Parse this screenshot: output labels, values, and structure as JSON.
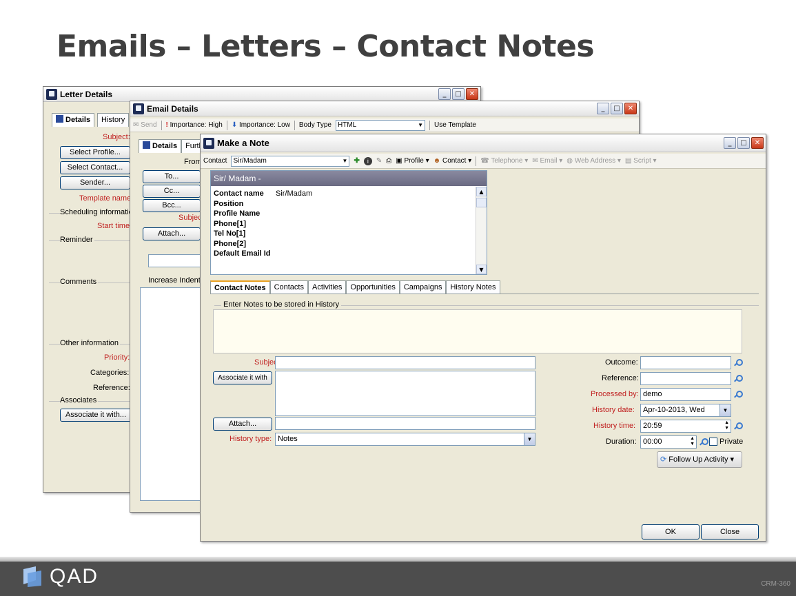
{
  "slide": {
    "title": "Emails – Letters – Contact Notes",
    "logo_text": "QAD",
    "slide_code": "CRM-360"
  },
  "letter_window": {
    "title": "Letter Details",
    "tabs": [
      "Details",
      "History"
    ],
    "subject_label": "Subject:",
    "buttons": [
      "Select Profile...",
      "Select Contact...",
      "Sender..."
    ],
    "template_label": "Template name:",
    "scheduling_label": "Scheduling information",
    "start_label": "Start time:",
    "reminder_label": "Reminder",
    "comments_label": "Comments",
    "other_label": "Other information",
    "priority_label": "Priority:",
    "categories_label": "Categories:",
    "reference_label": "Reference:",
    "associates_label": "Associates",
    "associate_button": "Associate it with..."
  },
  "email_window": {
    "title": "Email Details",
    "toolbar": {
      "send": "Send",
      "importance_high": "Importance: High",
      "importance_low": "Importance: Low",
      "body_type_label": "Body Type",
      "body_type_value": "HTML",
      "use_template": "Use Template"
    },
    "tabs": [
      "Details",
      "Furth"
    ],
    "from_label": "From",
    "buttons": [
      "To...",
      "Cc...",
      "Bcc...",
      "Attach..."
    ],
    "subject_label": "Subject",
    "increase_indent": "Increase Indent"
  },
  "note_window": {
    "title": "Make a Note",
    "toolbar": {
      "contact_label": "Contact",
      "contact_value": "Sir/Madam",
      "profile": "Profile",
      "contact_menu": "Contact",
      "telephone": "Telephone",
      "email": "Email",
      "web_address": "Web Address",
      "script": "Script"
    },
    "contact_header": "Sir/ Madam -",
    "contact_fields": [
      {
        "label": "Contact name",
        "value": "Sir/Madam"
      },
      {
        "label": "Position",
        "value": ""
      },
      {
        "label": "Profile Name",
        "value": ""
      },
      {
        "label": "Phone[1]",
        "value": ""
      },
      {
        "label": "Tel No[1]",
        "value": ""
      },
      {
        "label": "Phone[2]",
        "value": ""
      },
      {
        "label": "Default Email Id",
        "value": ""
      }
    ],
    "tabs": [
      "Contact Notes",
      "Contacts",
      "Activities",
      "Opportunities",
      "Campaigns",
      "History Notes"
    ],
    "notes_group_label": "Enter Notes to be stored in History",
    "subject_label": "Subject:",
    "associate_button": "Associate it with",
    "attach_button": "Attach...",
    "history_type_label": "History type:",
    "history_type_value": "Notes",
    "outcome_label": "Outcome:",
    "reference_label": "Reference:",
    "processed_by_label": "Processed by:",
    "processed_by_value": "demo",
    "history_date_label": "History date:",
    "history_date_value": "Apr-10-2013, Wed",
    "history_time_label": "History time:",
    "history_time_value": "20:59",
    "duration_label": "Duration:",
    "duration_value": "00:00",
    "private_label": "Private",
    "follow_up": "Follow Up Activity",
    "ok": "OK",
    "close": "Close"
  },
  "colors": {
    "title_text": "#404040",
    "required_label": "#c02020",
    "footer": "#4d4d4d",
    "notes_bg": "#fffdf0"
  }
}
